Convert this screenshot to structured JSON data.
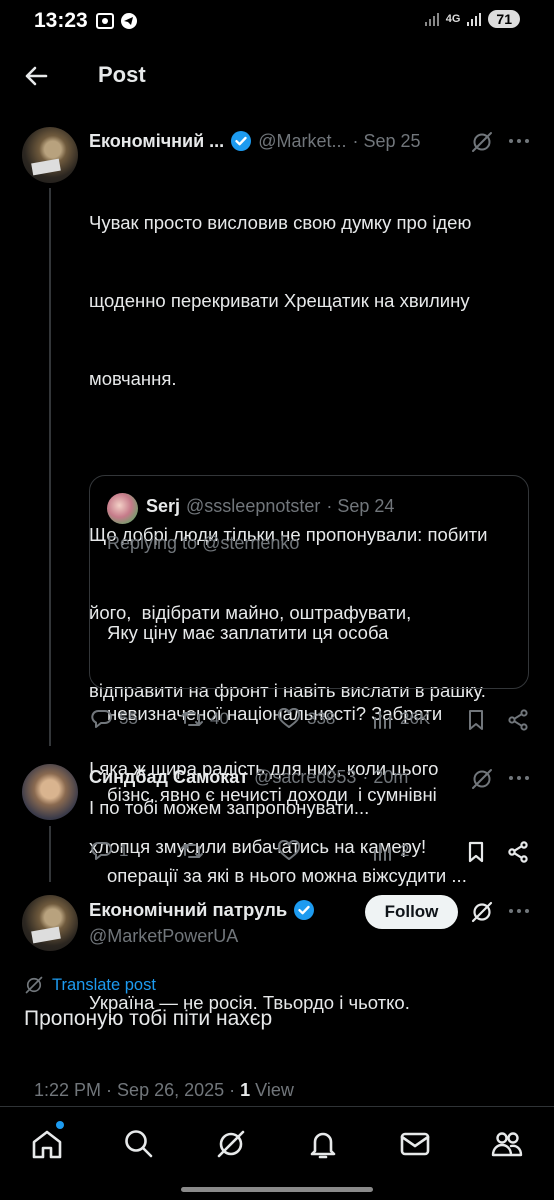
{
  "status": {
    "time": "13:23",
    "network": "4G",
    "battery": "71"
  },
  "header": {
    "title": "Post"
  },
  "tweet1": {
    "name": "Економічний ...",
    "handle": "@Market...",
    "date": "· Sep 25",
    "lines": [
      "Чувак просто висловив свою думку про ідею",
      "щоденно перекривати Хрещатик на хвилину",
      "мовчання.",
      "",
      "Що добрі люди тільки не пропонували: побити",
      "його,  відібрати майно, оштрафувати,",
      "відправити на фронт і навіть вислати в рашку.",
      "І яка ж щира радість для них, коли цього",
      "хлопця змусили вибачатись на камеру!",
      "",
      "Україна — не росія. Твьордо і чьотко."
    ],
    "quote": {
      "name": "Serj",
      "handle": "@sssleepnotster",
      "date": "· Sep 24",
      "replying_prefix": "Replying to ",
      "replying_user": "@sternenko",
      "lines": [
        "Яку ціну має заплатити ця особа",
        "невизначеної національності? Забрати",
        "бізнс, явно є нечисті доходи  і сумнівні",
        "операції за які в нього можна віжсудити ..."
      ]
    },
    "replies": "55",
    "reposts": "40",
    "likes": "338",
    "views": "26K"
  },
  "tweet2": {
    "name": "Синдбад Самокат",
    "handle": "@sacred953",
    "date": "· 20m",
    "text": "І по тобі можем запропонувати...",
    "replies": "1",
    "views": "2"
  },
  "main": {
    "name": "Економічний патруль",
    "handle": "@MarketPowerUA",
    "follow_label": "Follow",
    "translate_label": "Translate post",
    "text": "Пропоную тобі піти нахєр",
    "time": "1:22 PM · Sep 26, 2025 · ",
    "views_count": "1",
    "views_label": " View"
  },
  "colors": {
    "accent": "#1d9bf0",
    "background": "#000000",
    "text": "#e7e9ea",
    "muted": "#71767b"
  },
  "icons": [
    "back-arrow-icon",
    "verified-icon",
    "grok-icon",
    "more-icon",
    "reply-icon",
    "repost-icon",
    "like-icon",
    "views-icon",
    "bookmark-icon",
    "share-icon",
    "home-icon",
    "search-icon",
    "bell-icon",
    "mail-icon",
    "communities-icon"
  ]
}
